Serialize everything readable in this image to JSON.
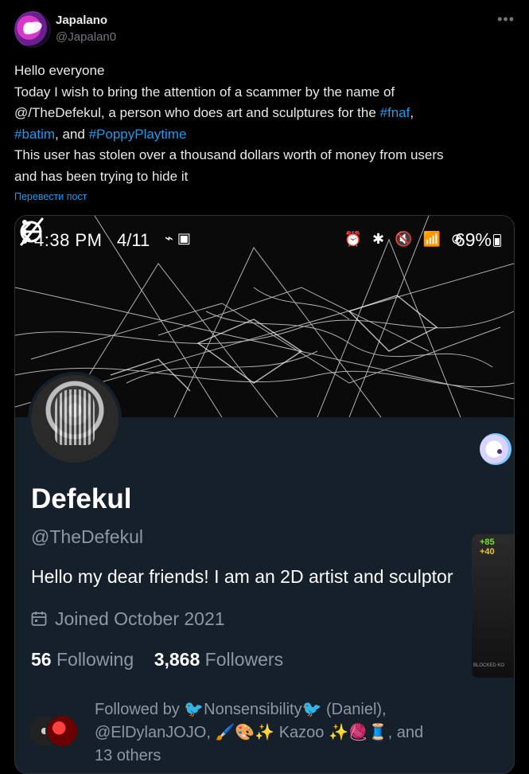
{
  "post": {
    "author_name": "Japalano",
    "author_handle": "@Japalan0",
    "more_icon": "•••",
    "text_lines": [
      [
        {
          "text": "Hello everyone"
        }
      ],
      [
        {
          "text": "Today I wish to bring the attention of a scammer by the name of"
        }
      ],
      [
        {
          "text": "@/TheDefekul, a person who does art and sculptures for the "
        },
        {
          "text": "#fnaf",
          "tag": true
        },
        {
          "text": ","
        }
      ],
      [
        {
          "text": "#batim",
          "tag": true
        },
        {
          "text": ", and "
        },
        {
          "text": "#PoppyPlaytime",
          "tag": true
        }
      ],
      [
        {
          "text": "This user has stolen over a thousand dollars worth of money from users"
        }
      ],
      [
        {
          "text": "and has been trying to hide it"
        }
      ]
    ],
    "translate_label": "Перевести пост"
  },
  "screenshot": {
    "status": {
      "time": "4:38 PM",
      "date": "4/11",
      "left_icons": "⌁ ▣",
      "right_icons": "⏰ ✱ 🔇 📶 ⊘",
      "battery": "69%"
    },
    "profile": {
      "name": "Defekul",
      "handle": "@TheDefekul",
      "bio": "Hello my dear friends! I am an 2D artist and sculptor",
      "joined": "Joined October 2021",
      "following_count": "56",
      "following_label": "Following",
      "followers_count": "3,868",
      "followers_label": "Followers",
      "followed_by": "Followed by 🐦Nonsensibility🐦 (Daniel), @ElDylanJOJO, 🖌️🎨✨ Kazoo ✨🧶🧵, and 13 others"
    },
    "popup": {
      "line1": "+85",
      "line2": "+40",
      "small": "BLOCKED KO"
    }
  },
  "colors": {
    "accent": "#1d9bf0",
    "background": "#000000",
    "card": "#15202b"
  }
}
